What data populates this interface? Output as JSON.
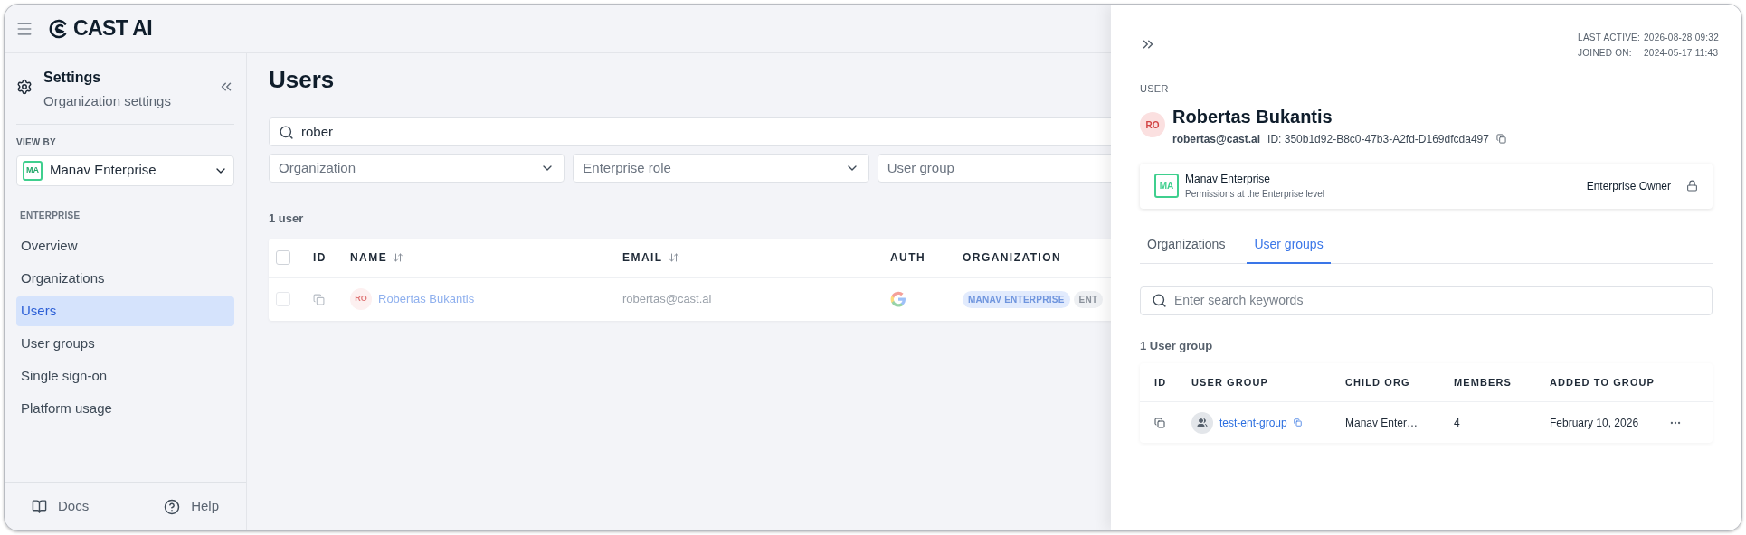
{
  "app": {
    "brand": "CAST AI"
  },
  "sidebar": {
    "title": "Settings",
    "subtitle": "Organization settings",
    "view_by_label": "VIEW BY",
    "org_select": {
      "initials": "MA",
      "value": "Manav Enterprise"
    },
    "section_label": "ENTERPRISE",
    "items": [
      {
        "label": "Overview",
        "selected": false
      },
      {
        "label": "Organizations",
        "selected": false
      },
      {
        "label": "Users",
        "selected": true
      },
      {
        "label": "User groups",
        "selected": false
      },
      {
        "label": "Single sign-on",
        "selected": false
      },
      {
        "label": "Platform usage",
        "selected": false
      }
    ],
    "footer": [
      {
        "kind": "docs",
        "label": "Docs"
      },
      {
        "kind": "help",
        "label": "Help"
      }
    ]
  },
  "main": {
    "title": "Users",
    "search": {
      "value": "rober"
    },
    "filters": [
      {
        "placeholder": "Organization"
      },
      {
        "placeholder": "Enterprise role"
      },
      {
        "placeholder": "User group"
      }
    ],
    "count": "1 user",
    "table": {
      "header_checked": false,
      "columns": [
        {
          "label": "ID",
          "sortable": false
        },
        {
          "label": "NAME",
          "sortable": true
        },
        {
          "label": "EMAIL",
          "sortable": true
        },
        {
          "label": "AUTH",
          "sortable": false
        },
        {
          "label": "ORGANIZATION",
          "sortable": false
        }
      ],
      "rows": [
        {
          "checked": false,
          "initials": "RO",
          "name": "Robertas Bukantis",
          "email": "robertas@cast.ai",
          "organizations": [
            "MANAV ENTERPRISE",
            "ENT"
          ]
        }
      ]
    }
  },
  "panel": {
    "meta": [
      {
        "label": "LAST ACTIVE:",
        "value": "2026-08-28 09:32"
      },
      {
        "label": "JOINED ON:",
        "value": "2024-05-17 11:43"
      }
    ],
    "section_label": "USER",
    "user": {
      "initials": "RO",
      "name": "Robertas Bukantis",
      "email": "robertas@cast.ai",
      "id": "ID: 350b1d92-B8c0-47b3-A2fd-D169dfcda497"
    },
    "org_card": {
      "initials": "MA",
      "name": "Manav Enterprise",
      "description": "Permissions at the Enterprise level",
      "role": "Enterprise Owner"
    },
    "tabs": [
      {
        "label": "Organizations",
        "selected": false
      },
      {
        "label": "User groups",
        "selected": true
      }
    ],
    "search": {
      "placeholder": "Enter search keywords"
    },
    "count": "1 User group",
    "table": {
      "columns": [
        "ID",
        "USER GROUP",
        "CHILD ORG",
        "MEMBERS",
        "ADDED TO GROUP"
      ],
      "rows": [
        {
          "group": "test-ent-group",
          "child_org": "Manav Enter…",
          "members": "4",
          "added": "February 10, 2026"
        }
      ]
    }
  }
}
